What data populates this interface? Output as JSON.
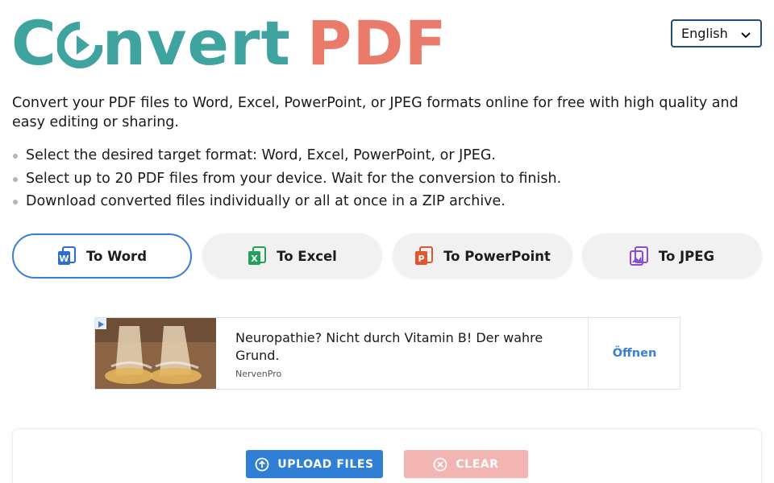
{
  "header": {
    "logo_convert_1": "C",
    "logo_convert_2": "nvert",
    "logo_pdf": "PDF",
    "language": "English"
  },
  "intro": {
    "text": "Convert your PDF files to Word, Excel, PowerPoint, or JPEG formats online for free with high quality and easy editing or sharing.",
    "steps": [
      "Select the desired target format: Word, Excel, PowerPoint, or JPEG.",
      "Select up to 20 PDF files from your device. Wait for the conversion to finish.",
      "Download converted files individually or all at once in a ZIP archive."
    ]
  },
  "tabs": [
    {
      "label": "To Word",
      "icon": "word-icon",
      "color": "#2b6fd0",
      "active": true
    },
    {
      "label": "To Excel",
      "icon": "excel-icon",
      "color": "#22a05a",
      "active": false
    },
    {
      "label": "To PowerPoint",
      "icon": "powerpoint-icon",
      "color": "#e0562e",
      "active": false
    },
    {
      "label": "To JPEG",
      "icon": "jpeg-icon",
      "color": "#8a4fd0",
      "active": false
    }
  ],
  "ad": {
    "title": "Neuropathie? Nicht durch Vitamin B! Der wahre Grund.",
    "source": "NervenPro",
    "cta": "Öffnen"
  },
  "actions": {
    "upload_label": "UPLOAD FILES",
    "clear_label": "CLEAR"
  },
  "colors": {
    "brand_teal": "#3fa3a0",
    "brand_coral": "#ea7a6a",
    "accent_blue": "#2f7fd6"
  }
}
